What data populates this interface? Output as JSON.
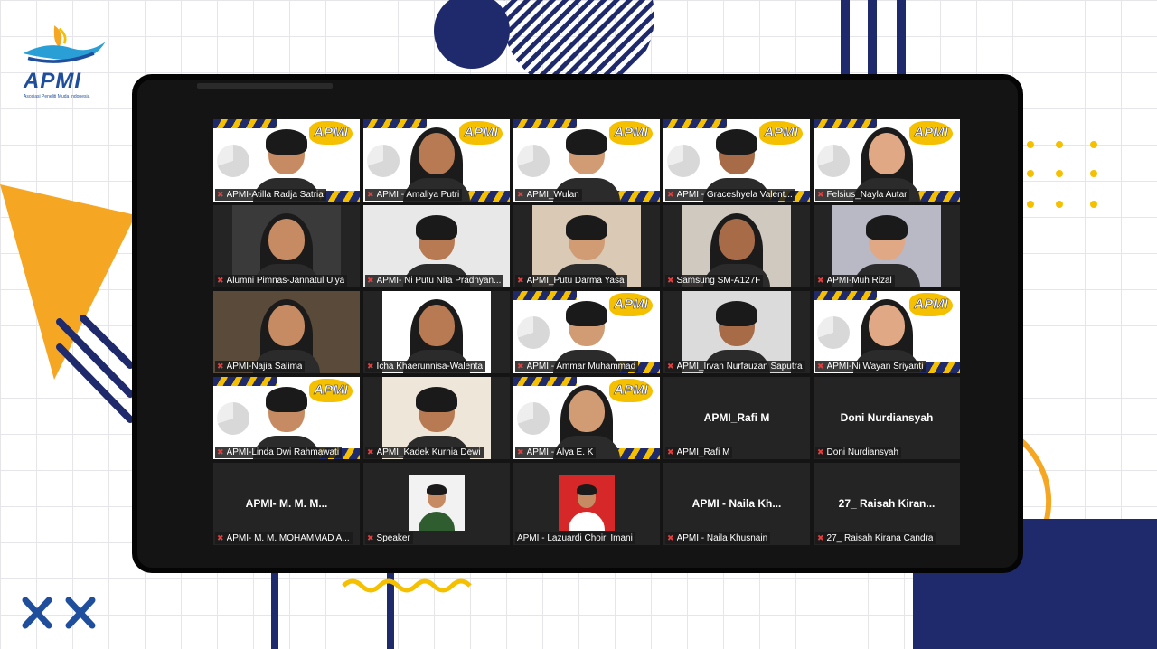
{
  "brand": {
    "name": "APMI",
    "tagline": "Asosiasi Peneliti Muda Indonesia",
    "colors": {
      "navy": "#1e2a6b",
      "blue": "#1f4e9c",
      "yellow": "#f5c000",
      "orange": "#f5a623"
    }
  },
  "banner_text": "APMI",
  "participants": [
    {
      "label": "APMI-Atilla Radja Satria",
      "muted": true,
      "tile": "banner"
    },
    {
      "label": "APMI - Amaliya Putri",
      "muted": true,
      "tile": "banner"
    },
    {
      "label": "APMI_Wulan",
      "muted": true,
      "tile": "banner"
    },
    {
      "label": "APMI - Graceshyela Valent...",
      "muted": true,
      "tile": "banner"
    },
    {
      "label": "Felsius_Nayla Autar",
      "muted": true,
      "tile": "banner"
    },
    {
      "label": "Alumni Pimnas-Jannatul Ulya",
      "muted": true,
      "tile": "video"
    },
    {
      "label": "APMI- Ni Putu Nita Pradnyan...",
      "muted": true,
      "tile": "video"
    },
    {
      "label": "APMI_Putu Darma Yasa",
      "muted": true,
      "tile": "video"
    },
    {
      "label": "Samsung SM-A127F",
      "muted": true,
      "tile": "video"
    },
    {
      "label": "APMI-Muh Rizal",
      "muted": true,
      "tile": "video"
    },
    {
      "label": "APMI-Najia Salima",
      "muted": true,
      "tile": "video"
    },
    {
      "label": "Icha Khaerunnisa-Walenta",
      "muted": true,
      "tile": "video"
    },
    {
      "label": "APMI - Ammar Muhammad",
      "muted": true,
      "tile": "banner"
    },
    {
      "label": "APMI_Irvan Nurfauzan Saputra",
      "muted": true,
      "tile": "video"
    },
    {
      "label": "APMI-Ni Wayan Sriyanti",
      "muted": true,
      "tile": "banner"
    },
    {
      "label": "APMI-Linda Dwi Rahmawati",
      "muted": true,
      "tile": "banner"
    },
    {
      "label": "APMI_Kadek Kurnia Dewi",
      "muted": true,
      "tile": "video"
    },
    {
      "label": "APMI - Alya E. K",
      "muted": true,
      "tile": "banner"
    },
    {
      "label": "APMI_Rafi M",
      "muted": true,
      "tile": "name",
      "display_name": "APMI_Rafi M"
    },
    {
      "label": "Doni Nurdiansyah",
      "muted": true,
      "tile": "name",
      "display_name": "Doni Nurdiansyah"
    },
    {
      "label": "APMI- M. M. MOHAMMAD A...",
      "muted": true,
      "tile": "name",
      "display_name": "APMI- M. M. M..."
    },
    {
      "label": "Speaker",
      "muted": true,
      "tile": "photo"
    },
    {
      "label": "APMI - Lazuardi Choiri Imani",
      "muted": false,
      "tile": "photo"
    },
    {
      "label": "APMI - Naila Khusnain",
      "muted": true,
      "tile": "name",
      "display_name": "APMI - Naila Kh..."
    },
    {
      "label": "27_ Raisah Kirana Candra",
      "muted": true,
      "tile": "name",
      "display_name": "27_ Raisah Kiran..."
    }
  ],
  "icons": {
    "mic": "mic-muted-icon"
  }
}
